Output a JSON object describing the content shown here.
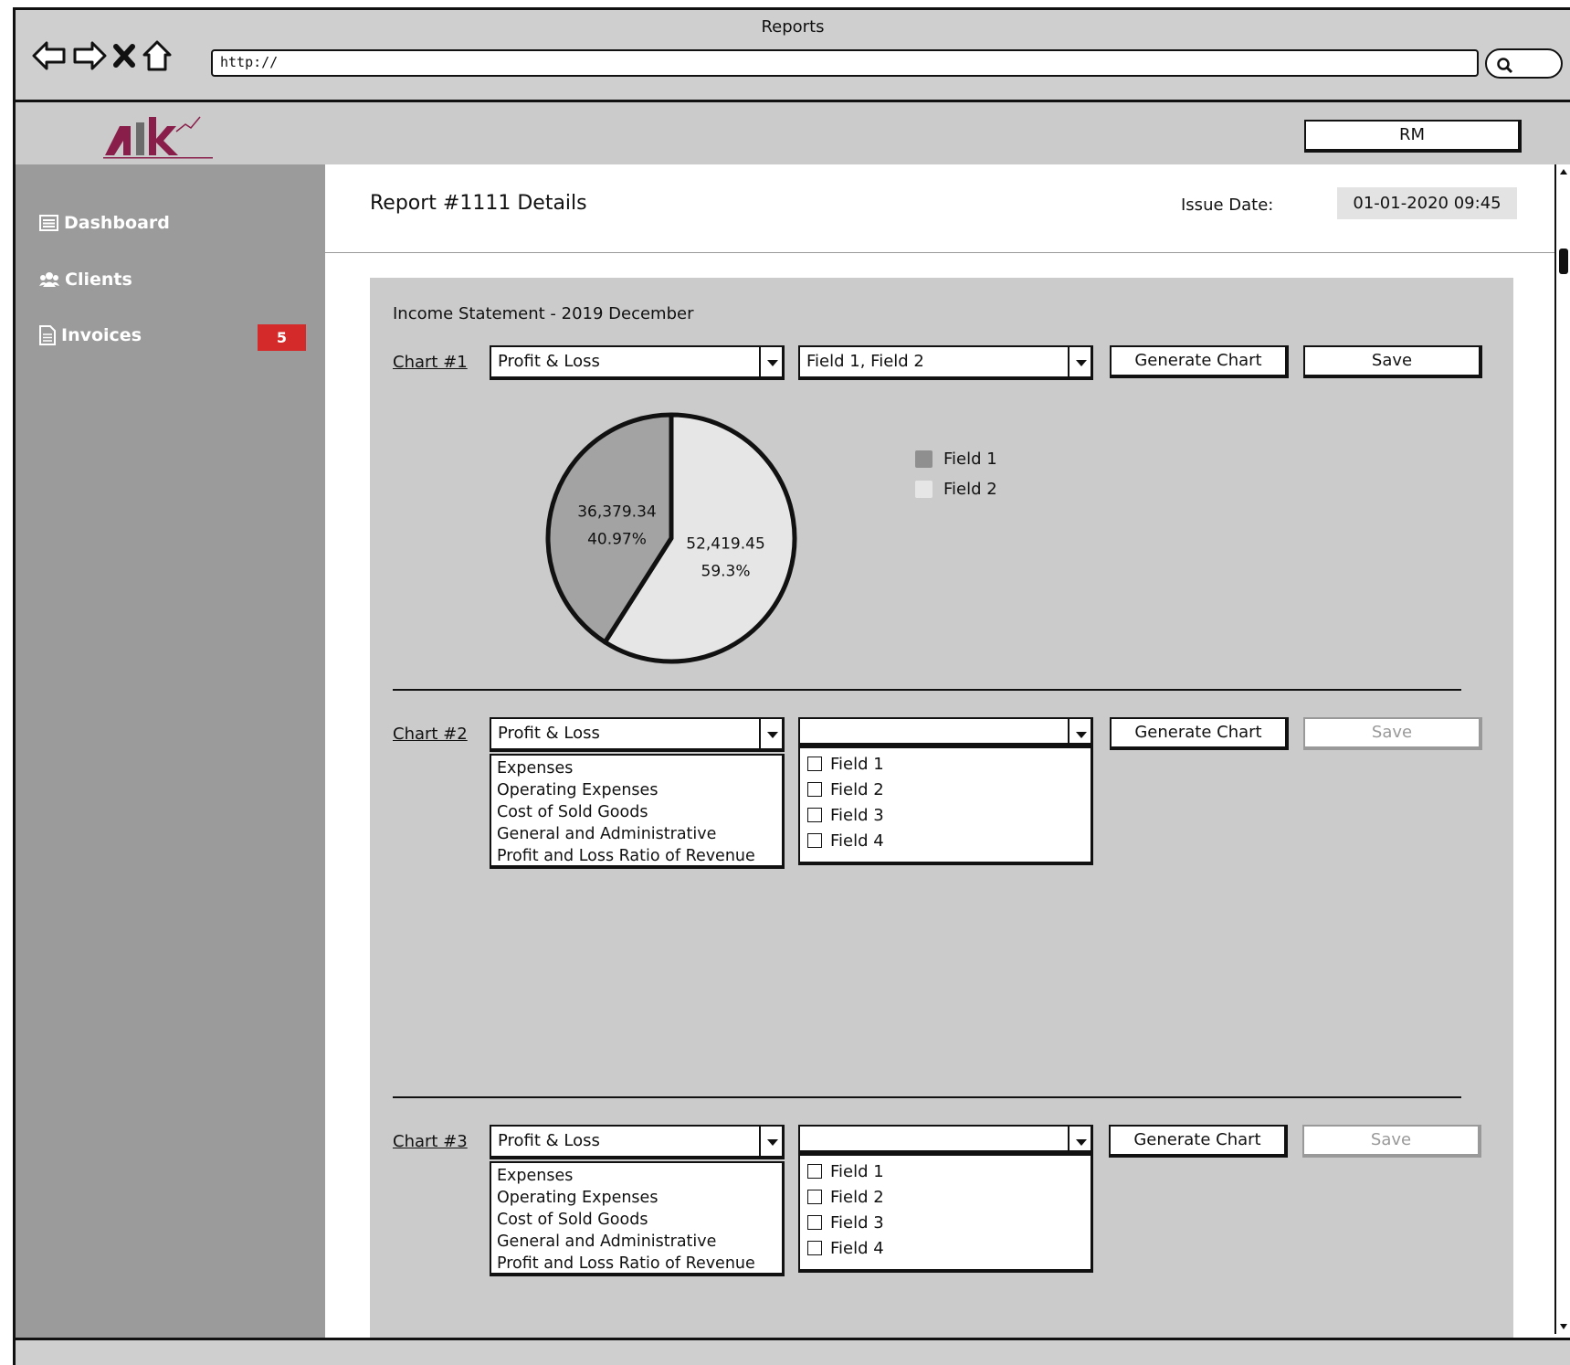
{
  "window": {
    "title": "Reports"
  },
  "browser": {
    "url": "http://"
  },
  "header": {
    "user_label": "RM"
  },
  "sidebar": {
    "items": [
      {
        "label": "Dashboard"
      },
      {
        "label": "Clients"
      },
      {
        "label": "Invoices",
        "badge": "5"
      }
    ]
  },
  "main": {
    "title": "Report #1111 Details",
    "issue_date_label": "Issue Date:",
    "issue_date_value": "01-01-2020 09:45",
    "section_title": "Income Statement - 2019 December"
  },
  "charts": [
    {
      "label": "Chart #1",
      "report_select": "Profit & Loss",
      "fields_select": "Field 1, Field 2",
      "generate_label": "Generate Chart",
      "save_label": "Save",
      "save_enabled": true
    },
    {
      "label": "Chart #2",
      "report_select": "Profit & Loss",
      "fields_select": "",
      "generate_label": "Generate Chart",
      "save_label": "Save",
      "save_enabled": false,
      "report_options": [
        "Expenses",
        "Operating Expenses",
        "Cost of Sold Goods",
        "General and Administrative",
        "Profit and Loss Ratio of Revenue"
      ],
      "field_options": [
        "Field 1",
        "Field 2",
        "Field 3",
        "Field 4"
      ]
    },
    {
      "label": "Chart #3",
      "report_select": "Profit & Loss",
      "fields_select": "",
      "generate_label": "Generate Chart",
      "save_label": "Save",
      "save_enabled": false,
      "report_options": [
        "Expenses",
        "Operating Expenses",
        "Cost of Sold Goods",
        "General and Administrative",
        "Profit and Loss Ratio of Revenue"
      ],
      "field_options": [
        "Field 1",
        "Field 2",
        "Field 3",
        "Field 4"
      ]
    }
  ],
  "chart_data": {
    "type": "pie",
    "title": "",
    "slices": [
      {
        "name": "Field 1",
        "value": 36379.34,
        "value_label": "36,379.34",
        "percent_label": "40.97%",
        "color": "#a3a3a3"
      },
      {
        "name": "Field 2",
        "value": 52419.45,
        "value_label": "52,419.45",
        "percent_label": "59.3%",
        "color": "#e6e6e6"
      }
    ],
    "legend": [
      "Field 1",
      "Field 2"
    ],
    "legend_position": "right"
  },
  "colors": {
    "badge": "#d52a2a",
    "sidebar": "#9b9b9b",
    "panel": "#cbcbcb",
    "logo": "#8a1e4a"
  }
}
